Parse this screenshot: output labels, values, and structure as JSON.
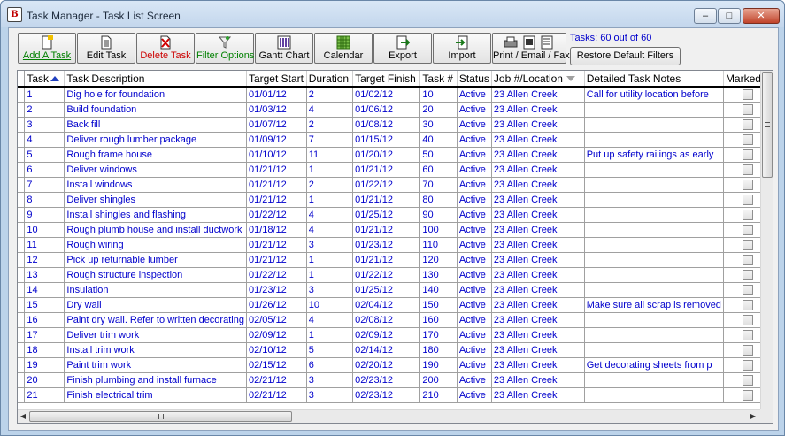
{
  "window": {
    "title": "Task Manager - Task List Screen",
    "min": "–",
    "max": "□",
    "close": "✕"
  },
  "toolbar": {
    "buttons": [
      {
        "label": "Add A Task",
        "color": "#008000"
      },
      {
        "label": "Edit Task",
        "color": "#000000"
      },
      {
        "label": "Delete Task",
        "color": "#cc0000"
      },
      {
        "label": "Filter Options",
        "color": "#008000"
      },
      {
        "label": "Gantt Chart",
        "color": "#000000"
      },
      {
        "label": "Calendar",
        "color": "#000000"
      },
      {
        "label": "Export",
        "color": "#000000"
      },
      {
        "label": "Import",
        "color": "#000000"
      },
      {
        "label": "Print / Email / Fax",
        "color": "#000000"
      }
    ],
    "status": "Tasks: 60 out of 60",
    "restore_label": "Restore Default Filters"
  },
  "grid": {
    "columns": [
      "Task",
      "Task Description",
      "Target Start",
      "Duration",
      "Target Finish",
      "Task #",
      "Status",
      "Job #/Location",
      "Detailed Task Notes",
      "Marked..."
    ],
    "rows": [
      [
        "1",
        "Dig hole for foundation",
        "01/01/12",
        "2",
        "01/02/12",
        "10",
        "Active",
        "23 Allen Creek",
        "Call for utility location before"
      ],
      [
        "2",
        "Build foundation",
        "01/03/12",
        "4",
        "01/06/12",
        "20",
        "Active",
        "23 Allen Creek",
        ""
      ],
      [
        "3",
        "Back fill",
        "01/07/12",
        "2",
        "01/08/12",
        "30",
        "Active",
        "23 Allen Creek",
        ""
      ],
      [
        "4",
        "Deliver rough lumber package",
        "01/09/12",
        "7",
        "01/15/12",
        "40",
        "Active",
        "23 Allen Creek",
        ""
      ],
      [
        "5",
        "Rough frame house",
        "01/10/12",
        "11",
        "01/20/12",
        "50",
        "Active",
        "23 Allen Creek",
        "Put up safety railings as early"
      ],
      [
        "6",
        "Deliver windows",
        "01/21/12",
        "1",
        "01/21/12",
        "60",
        "Active",
        "23 Allen Creek",
        ""
      ],
      [
        "7",
        "Install windows",
        "01/21/12",
        "2",
        "01/22/12",
        "70",
        "Active",
        "23 Allen Creek",
        ""
      ],
      [
        "8",
        "Deliver shingles",
        "01/21/12",
        "1",
        "01/21/12",
        "80",
        "Active",
        "23 Allen Creek",
        ""
      ],
      [
        "9",
        "Install shingles and flashing",
        "01/22/12",
        "4",
        "01/25/12",
        "90",
        "Active",
        "23 Allen Creek",
        ""
      ],
      [
        "10",
        "Rough plumb house and install ductwork",
        "01/18/12",
        "4",
        "01/21/12",
        "100",
        "Active",
        "23 Allen Creek",
        ""
      ],
      [
        "11",
        "Rough wiring",
        "01/21/12",
        "3",
        "01/23/12",
        "110",
        "Active",
        "23 Allen Creek",
        ""
      ],
      [
        "12",
        "Pick up returnable lumber",
        "01/21/12",
        "1",
        "01/21/12",
        "120",
        "Active",
        "23 Allen Creek",
        ""
      ],
      [
        "13",
        "Rough structure inspection",
        "01/22/12",
        "1",
        "01/22/12",
        "130",
        "Active",
        "23 Allen Creek",
        ""
      ],
      [
        "14",
        "Insulation",
        "01/23/12",
        "3",
        "01/25/12",
        "140",
        "Active",
        "23 Allen Creek",
        ""
      ],
      [
        "15",
        "Dry wall",
        "01/26/12",
        "10",
        "02/04/12",
        "150",
        "Active",
        "23 Allen Creek",
        "Make sure all scrap is removed"
      ],
      [
        "16",
        "Paint dry wall.  Refer to written decorating",
        "02/05/12",
        "4",
        "02/08/12",
        "160",
        "Active",
        "23 Allen Creek",
        ""
      ],
      [
        "17",
        "Deliver trim work",
        "02/09/12",
        "1",
        "02/09/12",
        "170",
        "Active",
        "23 Allen Creek",
        ""
      ],
      [
        "18",
        "Install trim work",
        "02/10/12",
        "5",
        "02/14/12",
        "180",
        "Active",
        "23 Allen Creek",
        ""
      ],
      [
        "19",
        "Paint trim work",
        "02/15/12",
        "6",
        "02/20/12",
        "190",
        "Active",
        "23 Allen Creek",
        "Get decorating sheets from p"
      ],
      [
        "20",
        "Finish plumbing and install furnace",
        "02/21/12",
        "3",
        "02/23/12",
        "200",
        "Active",
        "23 Allen Creek",
        ""
      ],
      [
        "21",
        "Finish electrical trim",
        "02/21/12",
        "3",
        "02/23/12",
        "210",
        "Active",
        "23 Allen Creek",
        ""
      ]
    ]
  },
  "scroll": {
    "left": "◀",
    "right": "▶"
  }
}
